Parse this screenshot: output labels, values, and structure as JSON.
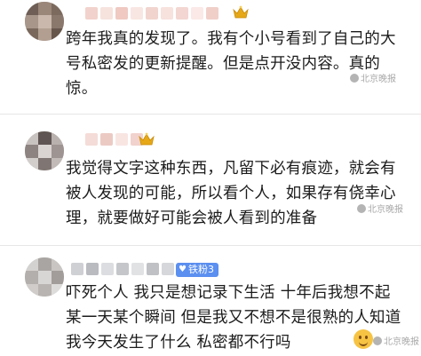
{
  "comments": [
    {
      "text": "跨年我真的发现了。我有个小号看到了自己的大号私密发的更新提醒。但是点开没内容。真的惊。",
      "watermark": "北京晚报",
      "crown_icon": "crown-icon"
    },
    {
      "text": "我觉得文字这种东西，凡留下必有痕迹，就会有被人发现的可能，所以看个人，如果存有侥幸心理，就要做好可能会被人看到的准备",
      "watermark": "北京晚报",
      "crown_icon": "crown-icon"
    },
    {
      "text": "吓死个人 我只是想记录下生活 十年后我想不起某一天某个瞬间 但是我又不想不是很熟的人知道我今天发生了什么 私密都不行吗",
      "badge": "铁粉3",
      "badge_icon": "heart-icon",
      "watermark": "北京晚报",
      "emoji_icon": "laughing-emoji-icon"
    }
  ],
  "colors": {
    "badge_blue": "#5b8ff0",
    "crown_gold": "#e6a817",
    "text": "#1b1b1b"
  }
}
